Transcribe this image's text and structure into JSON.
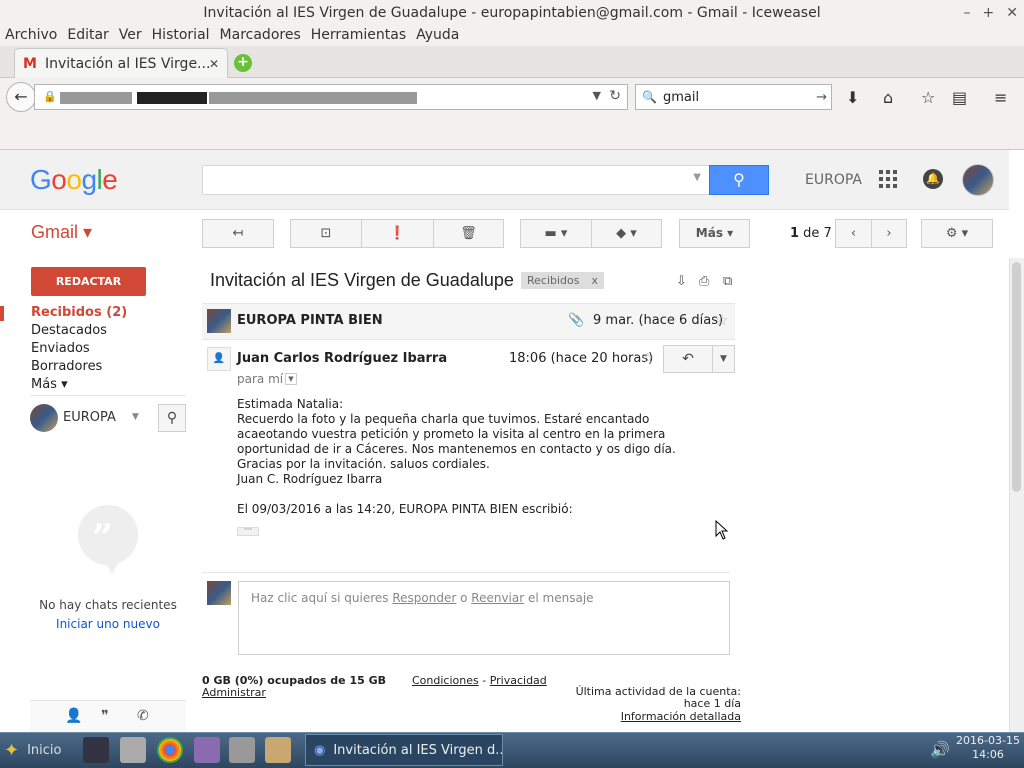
{
  "window": {
    "title": "Invitación al IES Virgen de Guadalupe - europapintabien@gmail.com - Gmail - Iceweasel",
    "controls": [
      "–",
      "+",
      "✕"
    ]
  },
  "menubar": [
    "Archivo",
    "Editar",
    "Ver",
    "Historial",
    "Marcadores",
    "Herramientas",
    "Ayuda"
  ],
  "tab": {
    "label": "Invitación al IES Virge...",
    "close": "✕"
  },
  "navbar": {
    "search_value": "gmail"
  },
  "google": {
    "logo": [
      "G",
      "o",
      "o",
      "g",
      "l",
      "e"
    ],
    "logo_colors": [
      "#4285f4",
      "#ea4335",
      "#fbbc05",
      "#4285f4",
      "#34a853",
      "#ea4335"
    ],
    "account_name": "EUROPA"
  },
  "gmail": {
    "label": "Gmail ▾",
    "more_label": "Más ▾",
    "page_current": "1",
    "page_of": " de 7"
  },
  "sidebar": {
    "compose": "REDACTAR",
    "items": [
      "Recibidos (2)",
      "Destacados",
      "Enviados",
      "Borradores",
      "Más ▾"
    ],
    "hangouts_name": "EUROPA",
    "no_chats": "No hay chats recientes",
    "start_new": "Iniciar uno nuevo"
  },
  "thread": {
    "subject": "Invitación al IES Virgen de Guadalupe",
    "label_chip": "Recibidos",
    "label_close": "x",
    "first_sender": "EUROPA PINTA BIEN",
    "first_date": "9 mar. (hace 6 días)",
    "second_sender": "Juan Carlos Rodríguez Ibarra",
    "second_time": "18:06 (hace 20 horas)",
    "to_me": "para mí",
    "body_lines": [
      "Estimada Natalia:",
      "Recuerdo la foto y la pequeña charla que tuvimos. Estaré encantado acaeotando vuestra petición y prometo la visita al centro en la primera oportunidad de ir a Cáceres. Nos mantenemos en contacto y os digo día.",
      "Gracias por la invitación. saluos cordiales.",
      "Juan C. Rodríguez Ibarra"
    ],
    "quote_line": "El 09/03/2016 a las 14:20, EUROPA PINTA BIEN escribió:",
    "ellipsis": "···",
    "reply_prefix": "Haz clic aquí si quieres ",
    "reply_link": "Responder",
    "reply_mid": " o ",
    "forward_link": "Reenviar",
    "reply_suffix": " el mensaje"
  },
  "footer": {
    "storage": "0 GB (0%) ocupados de 15 GB",
    "manage": "Administrar",
    "terms": "Condiciones",
    "dash": " - ",
    "privacy": "Privacidad",
    "last_activity": "Última actividad de la cuenta: hace 1 día",
    "details": "Información detallada"
  },
  "taskbar": {
    "start": "Inicio",
    "active_window": "Invitación al IES Virgen d...",
    "date": "2016-03-15",
    "time": "14:06"
  }
}
